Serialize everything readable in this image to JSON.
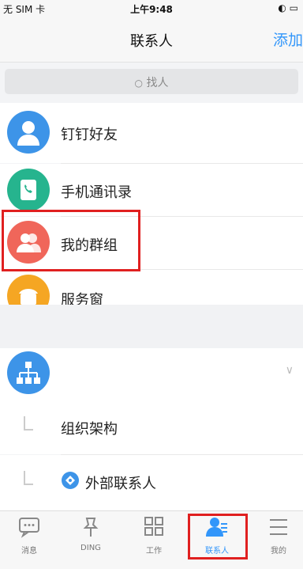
{
  "status_bar": {
    "carrier": "无 SIM 卡",
    "time": "上午9:48",
    "battery": "◐ ▭"
  },
  "nav": {
    "title": "联系人",
    "add": "添加"
  },
  "search": {
    "placeholder": "找人"
  },
  "rows": [
    {
      "label": "钉钉好友",
      "icon": "person-icon",
      "color": "#3d94e8"
    },
    {
      "label": "手机通讯录",
      "icon": "phonebook-icon",
      "color": "#26b48e"
    },
    {
      "label": "我的群组",
      "icon": "group-icon",
      "color": "#f0665a"
    },
    {
      "label": "服务窗",
      "icon": "service-window-icon",
      "color": "#f5a623"
    }
  ],
  "org": {
    "name": "",
    "sub_items": [
      "组织架构",
      "外部联系人"
    ]
  },
  "tabs": [
    {
      "label": "消息",
      "icon": "message-icon"
    },
    {
      "label": "DING",
      "icon": "pin-icon"
    },
    {
      "label": "工作",
      "icon": "grid-icon"
    },
    {
      "label": "联系人",
      "icon": "contacts-icon",
      "active": true
    },
    {
      "label": "我的",
      "icon": "menu-icon"
    }
  ],
  "colors": {
    "accent": "#3296fa",
    "highlight": "#e02020"
  }
}
